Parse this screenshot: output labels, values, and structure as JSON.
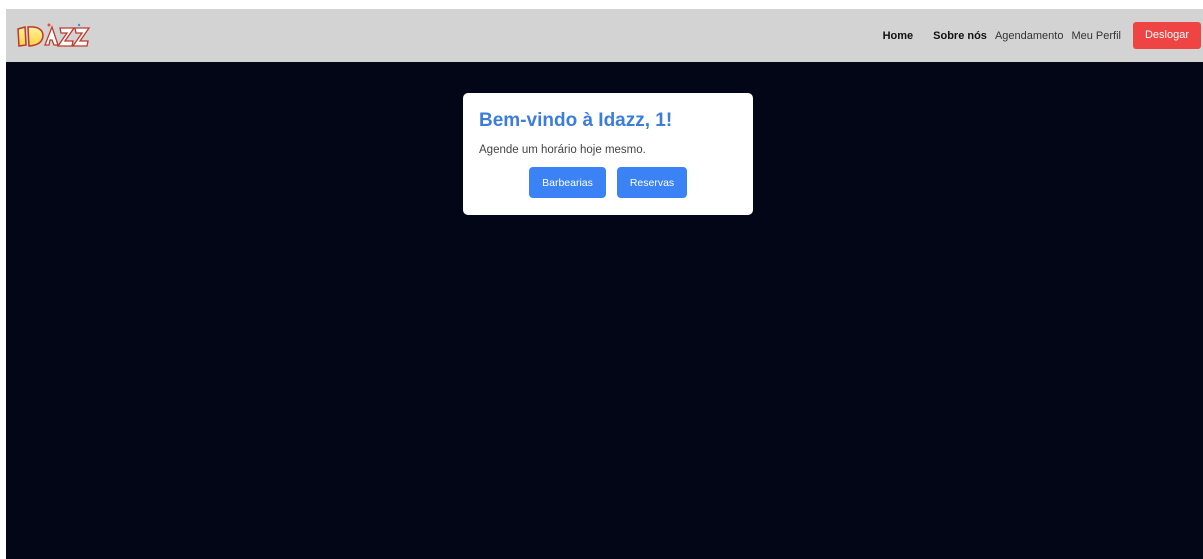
{
  "brand": {
    "logo_text": "IDAZZ",
    "logo_icon": "graffiti-logo"
  },
  "nav": {
    "items": [
      {
        "label": "Home"
      },
      {
        "label": "Sobre nós"
      },
      {
        "label": "Agendamento"
      },
      {
        "label": "Meu Perfil"
      }
    ],
    "logout_label": "Deslogar"
  },
  "welcome": {
    "title": "Bem-vindo à Idazz, 1!",
    "subtitle": "Agende um horário hoje mesmo.",
    "buttons": [
      {
        "label": "Barbearias"
      },
      {
        "label": "Reservas"
      }
    ]
  },
  "colors": {
    "navbar_bg": "#d3d3d3",
    "page_bg": "#020617",
    "accent": "#3b82f6",
    "title": "#3b7ddd",
    "danger": "#ef4444"
  }
}
